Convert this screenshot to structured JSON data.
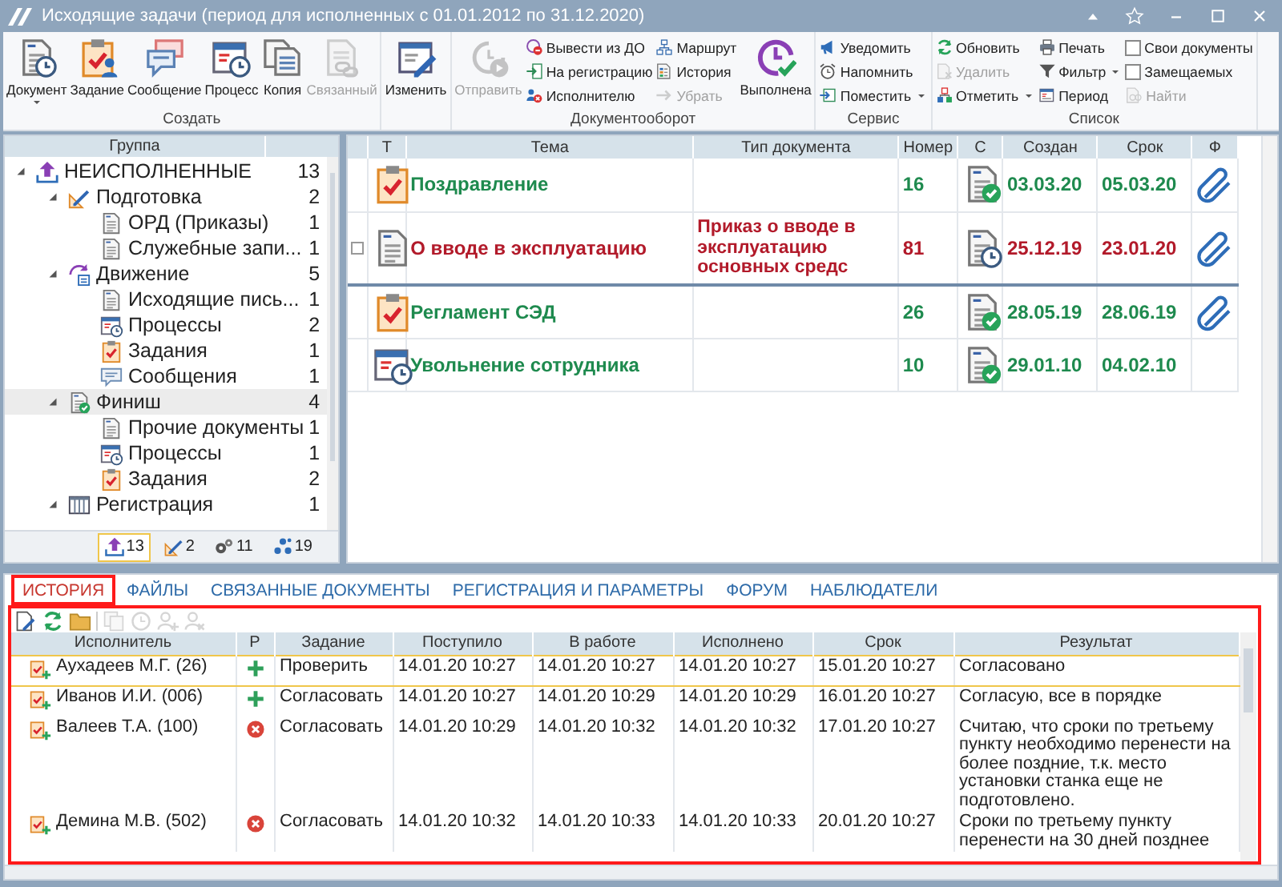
{
  "window": {
    "title": "Исходящие задачи (период для исполненных с 01.01.2012 по 31.12.2020)"
  },
  "ribbon": {
    "groups": [
      {
        "label": "Создать",
        "columns": [
          [
            {
              "kind": "large",
              "label": "Документ",
              "dropdown": true,
              "disabled": false
            }
          ],
          [
            {
              "kind": "large",
              "label": "Задание",
              "dropdown": false,
              "disabled": false
            }
          ],
          [
            {
              "kind": "large",
              "label": "Сообщение",
              "dropdown": false,
              "disabled": false
            }
          ],
          [
            {
              "kind": "large",
              "label": "Процесс",
              "dropdown": false,
              "disabled": false
            }
          ],
          [
            {
              "kind": "large",
              "label": "Копия",
              "dropdown": false,
              "disabled": false
            }
          ],
          [
            {
              "kind": "large",
              "label": "Связанный",
              "dropdown": false,
              "disabled": true
            }
          ]
        ]
      },
      {
        "columns": [
          [
            {
              "kind": "large",
              "label": "Изменить",
              "dropdown": false,
              "disabled": false
            }
          ]
        ]
      },
      {
        "label": "Документооборот",
        "columns": [
          [
            {
              "kind": "large",
              "label": "Отправить",
              "dropdown": false,
              "disabled": true
            }
          ],
          [
            {
              "kind": "small",
              "label": "Вывести из ДО",
              "dropdown": false,
              "disabled": false
            },
            {
              "kind": "small",
              "label": "На регистрацию",
              "dropdown": false,
              "disabled": false
            },
            {
              "kind": "small",
              "label": "Исполнителю",
              "dropdown": false,
              "disabled": false
            }
          ],
          [
            {
              "kind": "small",
              "label": "Маршрут",
              "dropdown": false,
              "disabled": false
            },
            {
              "kind": "small",
              "label": "История",
              "dropdown": false,
              "disabled": false
            },
            {
              "kind": "small",
              "label": "Убрать",
              "dropdown": false,
              "disabled": true
            }
          ],
          [
            {
              "kind": "large",
              "label": "Выполнена",
              "dropdown": false,
              "disabled": false
            }
          ]
        ]
      },
      {
        "label": "Сервис",
        "columns": [
          [
            {
              "kind": "small",
              "label": "Уведомить",
              "dropdown": false,
              "disabled": false
            },
            {
              "kind": "small",
              "label": "Напомнить",
              "dropdown": false,
              "disabled": false
            },
            {
              "kind": "small",
              "label": "Поместить",
              "dropdown": true,
              "disabled": false
            }
          ]
        ]
      },
      {
        "label": "Список",
        "columns": [
          [
            {
              "kind": "small",
              "label": "Обновить",
              "dropdown": false,
              "disabled": false
            },
            {
              "kind": "small",
              "label": "Удалить",
              "dropdown": false,
              "disabled": true
            },
            {
              "kind": "small",
              "label": "Отметить",
              "dropdown": true,
              "disabled": false
            }
          ],
          [
            {
              "kind": "small",
              "label": "Печать",
              "dropdown": false,
              "disabled": false
            },
            {
              "kind": "small",
              "label": "Фильтр",
              "dropdown": true,
              "disabled": false
            },
            {
              "kind": "small",
              "label": "Период",
              "dropdown": false,
              "disabled": false
            }
          ],
          [
            {
              "kind": "checkbox",
              "label": "Свои документы",
              "checked": false
            },
            {
              "kind": "checkbox",
              "label": "Замещаемых",
              "checked": false
            },
            {
              "kind": "small",
              "label": "Найти",
              "dropdown": false,
              "disabled": true
            }
          ]
        ]
      }
    ]
  },
  "tree": {
    "header": "Группа",
    "items": [
      {
        "kind": "outgoing",
        "label": "НЕИСПОЛНЕННЫЕ",
        "count": "13",
        "expanded": true,
        "selected": false,
        "children": [
          {
            "kind": "preparation",
            "label": "Подготовка",
            "count": "2",
            "expanded": true,
            "selected": false,
            "children": [
              {
                "kind": "document",
                "label": "ОРД (Приказы)",
                "count": "1",
                "selected": false
              },
              {
                "kind": "document",
                "label": "Служебные запи...",
                "count": "1",
                "selected": false
              }
            ]
          },
          {
            "kind": "movement",
            "label": "Движение",
            "count": "5",
            "expanded": true,
            "selected": false,
            "children": [
              {
                "kind": "document",
                "label": "Исходящие пись...",
                "count": "1",
                "selected": false
              },
              {
                "kind": "process",
                "label": "Процессы",
                "count": "2",
                "selected": false
              },
              {
                "kind": "task",
                "label": "Задания",
                "count": "1",
                "selected": false
              },
              {
                "kind": "message",
                "label": "Сообщения",
                "count": "1",
                "selected": false
              }
            ]
          },
          {
            "kind": "finish",
            "label": "Финиш",
            "count": "4",
            "expanded": true,
            "selected": true,
            "children": [
              {
                "kind": "document",
                "label": "Прочие документы",
                "count": "1",
                "selected": false
              },
              {
                "kind": "process",
                "label": "Процессы",
                "count": "1",
                "selected": false
              },
              {
                "kind": "task",
                "label": "Задания",
                "count": "2",
                "selected": false
              }
            ]
          },
          {
            "kind": "registration",
            "label": "Регистрация",
            "count": "1",
            "expanded": true,
            "selected": false
          }
        ]
      }
    ],
    "footer_tabs": [
      {
        "kind": "outgoing",
        "count": "13",
        "selected": true
      },
      {
        "kind": "preparation",
        "count": "2",
        "selected": false
      },
      {
        "kind": "gears",
        "count": "11",
        "selected": false
      },
      {
        "kind": "flow",
        "count": "19",
        "selected": false
      }
    ]
  },
  "grid": {
    "columns": [
      "Т",
      "Тема",
      "Тип документа",
      "Номер",
      "С",
      "Создан",
      "Срок",
      "Ф"
    ],
    "rows": [
      {
        "kind": "task",
        "subject": "Поздравление",
        "doc_type": "",
        "number": "16",
        "done": true,
        "created": "03.03.20",
        "due": "05.03.20",
        "attachment": true,
        "overdue": false,
        "selected": false
      },
      {
        "kind": "document",
        "subject": "О вводе в эксплуатацию",
        "doc_type": "Приказ о вводе в эксплуатацию основных средс",
        "number": "81",
        "done": false,
        "created": "25.12.19",
        "due": "23.01.20",
        "attachment": true,
        "overdue": true,
        "selected": true
      },
      {
        "kind": "task",
        "subject": "Регламент СЭД",
        "doc_type": "",
        "number": "26",
        "done": true,
        "created": "28.05.19",
        "due": "28.06.19",
        "attachment": true,
        "overdue": false,
        "selected": false
      },
      {
        "kind": "process",
        "subject": "Увольнение сотрудника",
        "doc_type": "",
        "number": "10",
        "done": true,
        "created": "29.01.10",
        "due": "04.02.10",
        "attachment": false,
        "overdue": false,
        "selected": false
      }
    ]
  },
  "detail_tabs": [
    {
      "label": "ИСТОРИЯ",
      "selected": true,
      "highlighted": true
    },
    {
      "label": "ФАЙЛЫ",
      "selected": false,
      "highlighted": false
    },
    {
      "label": "СВЯЗАННЫЕ ДОКУМЕНТЫ",
      "selected": false,
      "highlighted": false
    },
    {
      "label": "РЕГИСТРАЦИЯ И ПАРАМЕТРЫ",
      "selected": false,
      "highlighted": false
    },
    {
      "label": "ФОРУМ",
      "selected": false,
      "highlighted": false
    },
    {
      "label": "НАБЛЮДАТЕЛИ",
      "selected": false,
      "highlighted": false
    }
  ],
  "history": {
    "highlighted": true,
    "toolbar": [
      {
        "disabled": false
      },
      {
        "disabled": false
      },
      {
        "disabled": false
      },
      {
        "disabled": true
      },
      {
        "disabled": true
      },
      {
        "disabled": true
      },
      {
        "disabled": true
      }
    ],
    "columns": [
      "Исполнитель",
      "Р",
      "Задание",
      "Поступило",
      "В работе",
      "Исполнено",
      "Срок",
      "Результат"
    ],
    "rows": [
      {
        "executor": "Аухадеев М.Г. (26)",
        "accepted": true,
        "task": "Проверить",
        "received": "14.01.20 10:27",
        "in_work": "14.01.20 10:27",
        "done": "14.01.20 10:27",
        "due": "15.01.20 10:27",
        "result": "Согласовано",
        "selected": true
      },
      {
        "executor": "Иванов И.И. (006)",
        "accepted": true,
        "task": "Согласовать",
        "received": "14.01.20 10:27",
        "in_work": "14.01.20 10:29",
        "done": "14.01.20 10:29",
        "due": "16.01.20 10:27",
        "result": "Согласую, все в порядке",
        "selected": false
      },
      {
        "executor": "Валеев Т.А. (100)",
        "accepted": false,
        "task": "Согласовать",
        "received": "14.01.20 10:29",
        "in_work": "14.01.20 10:32",
        "done": "14.01.20 10:32",
        "due": "17.01.20 10:27",
        "result": "Считаю, что сроки по третьему пункту необходимо перенести на более поздние, т.к. место установки станка еще не подготовлено.",
        "selected": false
      },
      {
        "executor": "Демина М.В. (502)",
        "accepted": false,
        "task": "Согласовать",
        "received": "14.01.20 10:32",
        "in_work": "14.01.20 10:33",
        "done": "14.01.20 10:33",
        "due": "20.01.20 10:27",
        "result": "Сроки по третьему пункту перенести на 30 дней позднее",
        "selected": false
      }
    ]
  }
}
